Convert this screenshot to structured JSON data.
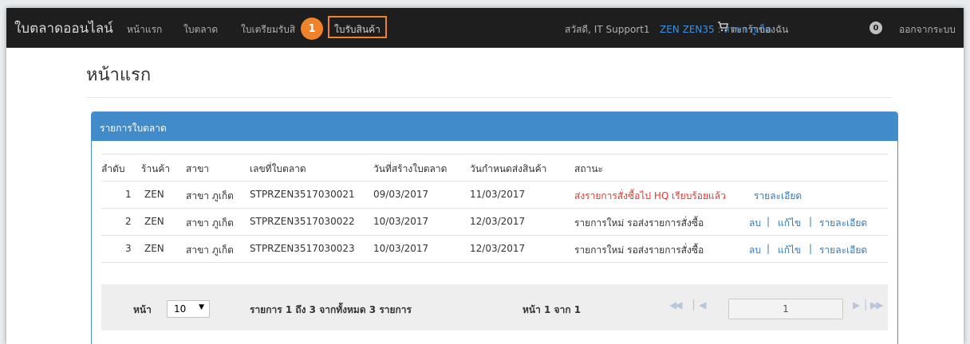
{
  "navbar": {
    "brand": "ใบตลาดออนไลน์",
    "links": [
      "หน้าแรก",
      "ใบตลาด",
      "ใบเตรียมรับสิ",
      "ใบรับสินค้า"
    ],
    "step_badge": "1",
    "greeting": "สวัสดี, IT Support1",
    "branch": "ZEN ZEN35 : สาขา ภูเก็ต",
    "cart_label": "ตะกร้าของฉัน",
    "cart_count": "0",
    "logout": "ออกจากระบบ"
  },
  "page": {
    "title": "หน้าแรก"
  },
  "panel": {
    "title": "รายการใบตลาด",
    "columns": [
      "ลำดับ",
      "ร้านค้า",
      "สาขา",
      "เลขที่ใบตลาด",
      "วันที่สร้างใบตลาด",
      "วันกำหนดส่งสินค้า",
      "สถานะ"
    ],
    "rows": [
      {
        "no": "1",
        "shop": "ZEN",
        "branch": "สาขา ภูเก็ต",
        "doc": "STPRZEN3517030021",
        "created": "09/03/2017",
        "due": "11/03/2017",
        "status": "ส่งรายการสั่งซื้อไป HQ เรียบร้อยแล้ว",
        "actions": [
          "รายละเอียด"
        ]
      },
      {
        "no": "2",
        "shop": "ZEN",
        "branch": "สาขา ภูเก็ต",
        "doc": "STPRZEN3517030022",
        "created": "10/03/2017",
        "due": "12/03/2017",
        "status": "รายการใหม่ รอส่งรายการสั่งซื้อ",
        "actions": [
          "ลบ",
          "แก้ไข",
          "รายละเอียด"
        ]
      },
      {
        "no": "3",
        "shop": "ZEN",
        "branch": "สาขา ภูเก็ต",
        "doc": "STPRZEN3517030023",
        "created": "10/03/2017",
        "due": "12/03/2017",
        "status": "รายการใหม่ รอส่งรายการสั่งซื้อ",
        "actions": [
          "ลบ",
          "แก้ไข",
          "รายละเอียด"
        ]
      }
    ],
    "separator": "|",
    "pager": {
      "page_label": "หน้า",
      "page_size": "10",
      "summary": "รายการ 1 ถึง 3 จากทั้งหมด 3 รายการ",
      "page_of": "หน้า 1 จาก 1",
      "current_page": "1"
    }
  },
  "colors": {
    "navbar_bg": "#1e1e1e",
    "panel_head": "#428bca",
    "accent": "#f0822a",
    "status_red": "#e8342b",
    "link": "#337ab7"
  }
}
